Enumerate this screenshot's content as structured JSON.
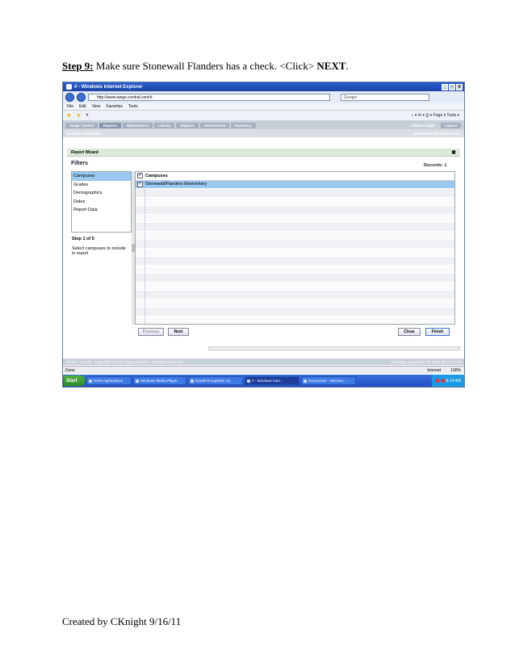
{
  "instruction": {
    "step_label": "Step 9:",
    "text": " Make sure Stonewall Flanders has a check.  <Click> ",
    "action": "NEXT",
    "end": "."
  },
  "footer": {
    "text": "Created by CKnight 9/16/11"
  },
  "browser": {
    "title": "# - Windows Internet Explorer",
    "window_buttons": [
      "_",
      "□",
      "X"
    ],
    "url": "http://www.tango-central.com/#",
    "search_placeholder": "Google",
    "menu": [
      "File",
      "Edit",
      "View",
      "Favorites",
      "Tools"
    ],
    "tab_title": "#",
    "toolbar_tools": "⌂ ▾  ✉ ▾  ⎙ ▾  Page ▾  Tools ▾",
    "status": "Done",
    "zone": "Internet",
    "zoom": "100%"
  },
  "app": {
    "nav": [
      "Tango Central",
      "Reports",
      "Maintenance",
      "Library",
      "Support",
      "Assessment",
      "Inventory"
    ],
    "user": "collette.knight",
    "logout": "Logout",
    "breadcrumb": "Reports Information",
    "school": "Harlandale ISD (2011-2012)",
    "footer_left": "Version: 4.11.48 · Copyright © 2011 Tango Software. All Rights Reserved.",
    "footer_right": "Thursday, September 15, 2011 09:14:15 AM"
  },
  "wizard": {
    "title": "Report Wizard",
    "close": "✖",
    "filters_heading": "Filters",
    "records": "Records: 1",
    "steps": [
      "Campuses",
      "Grades",
      "Demographics",
      "Dates",
      "Report Data"
    ],
    "step_of": "Step 1 of 5",
    "instruction": "Select campuses to include in report",
    "grid_header": "Campuses",
    "rows": [
      {
        "name": "Stonewall/Flanders Elementary",
        "checked": true
      }
    ],
    "buttons": {
      "previous": "Previous",
      "next": "Next",
      "close": "Close",
      "finish": "Finish"
    }
  },
  "taskbar": {
    "start": "Start",
    "items": [
      "HISD Applications",
      "Windows Media Player",
      "Novell GroupWise Ca...",
      "# - Windows Inter...",
      "Document1 - Microso..."
    ],
    "active": 3,
    "clock": "8:14 AM"
  }
}
